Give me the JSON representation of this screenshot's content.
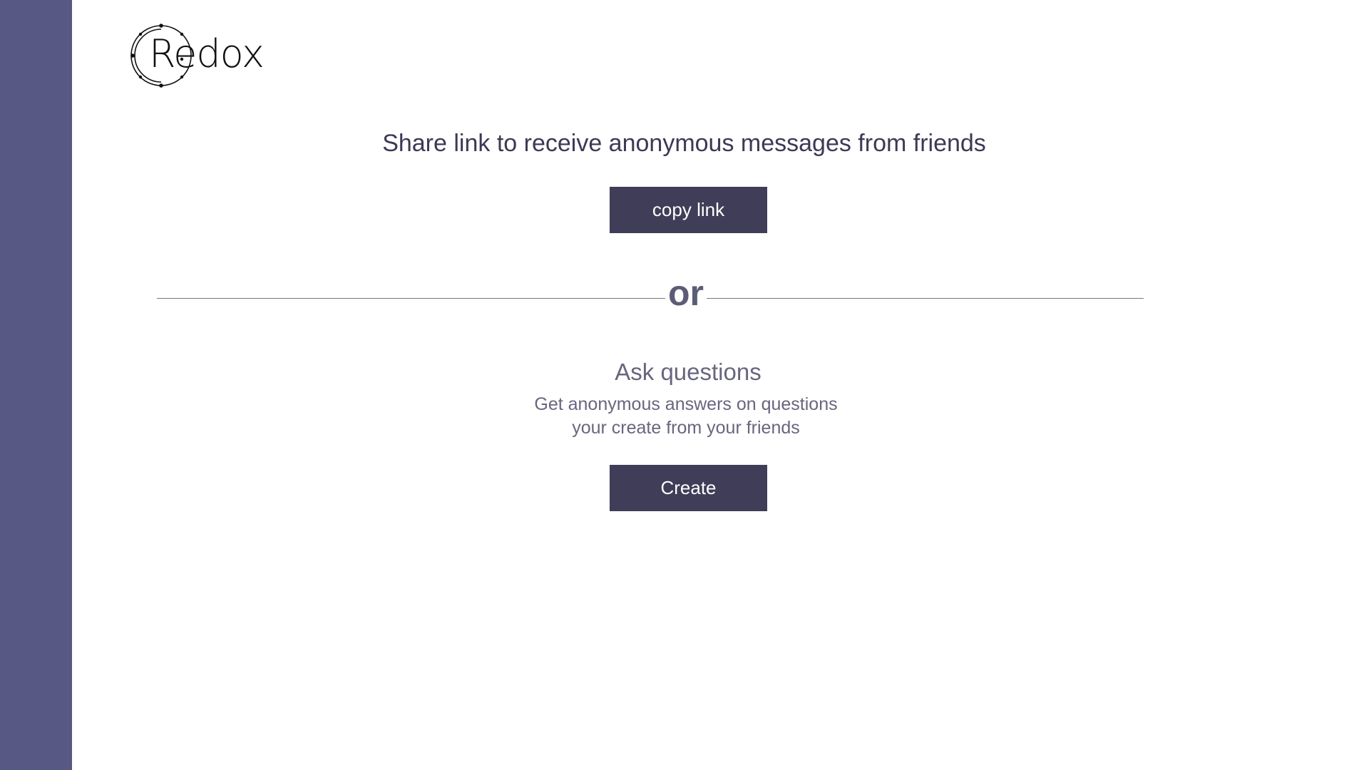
{
  "colors": {
    "sidebar": "#575883",
    "button": "#3f3d57",
    "button_text": "#ffffff",
    "heading": "#3b3a55",
    "muted": "#67667f",
    "background": "#ffffff"
  },
  "logo": {
    "text": "Redox",
    "icon": "orbit-ring-icon"
  },
  "share": {
    "title": "Share link to receive anonymous messages from friends",
    "button_label": "copy link"
  },
  "divider": {
    "label": "or"
  },
  "ask": {
    "title": "Ask questions",
    "description_line1": "Get anonymous answers on questions",
    "description_line2": "your create from your friends",
    "button_label": "Create"
  }
}
